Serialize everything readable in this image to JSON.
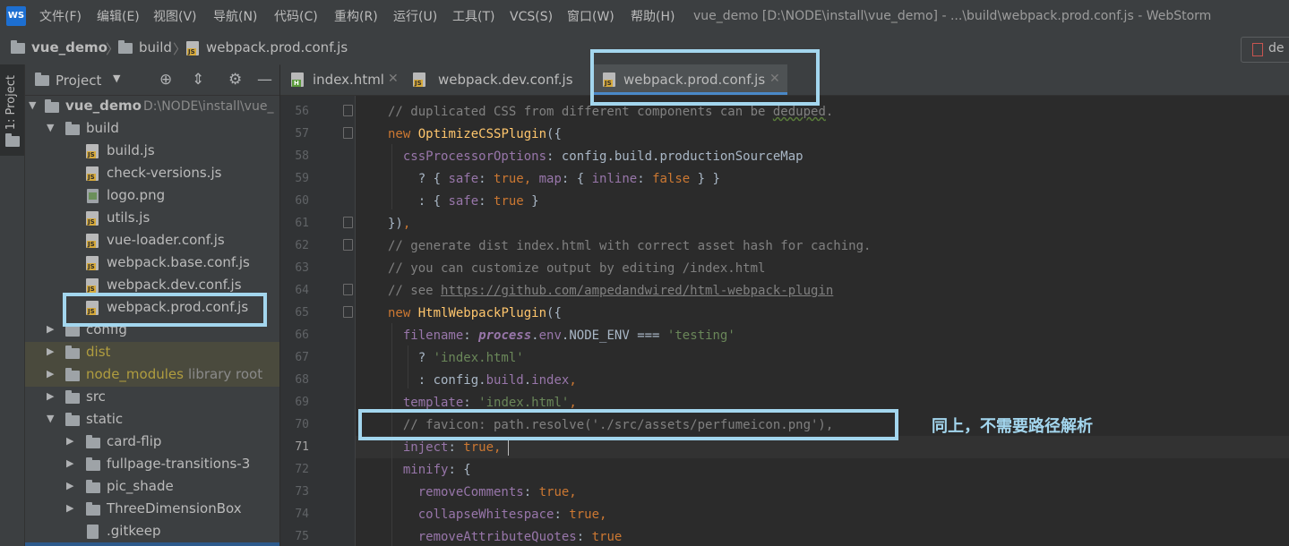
{
  "menubar": {
    "items": [
      "文件(F)",
      "编辑(E)",
      "视图(V)",
      "导航(N)",
      "代码(C)",
      "重构(R)",
      "运行(U)",
      "工具(T)",
      "VCS(S)",
      "窗口(W)",
      "帮助(H)"
    ],
    "window_title": "vue_demo [D:\\NODE\\install\\vue_demo] - ...\\build\\webpack.prod.conf.js - WebStorm",
    "logo": "WS"
  },
  "breadcrumb": [
    "vue_demo",
    "build",
    "webpack.prod.conf.js"
  ],
  "right_tab_label": "de",
  "toolstrip": {
    "project_label": "1: Project"
  },
  "project_panel": {
    "title": "Project",
    "tree": [
      {
        "label": "vue_demo",
        "path": "D:\\NODE\\install\\vue_",
        "kind": "root"
      },
      {
        "label": "build",
        "kind": "folder"
      },
      {
        "label": "build.js",
        "kind": "js"
      },
      {
        "label": "check-versions.js",
        "kind": "js"
      },
      {
        "label": "logo.png",
        "kind": "png"
      },
      {
        "label": "utils.js",
        "kind": "js"
      },
      {
        "label": "vue-loader.conf.js",
        "kind": "js"
      },
      {
        "label": "webpack.base.conf.js",
        "kind": "js"
      },
      {
        "label": "webpack.dev.conf.js",
        "kind": "js"
      },
      {
        "label": "webpack.prod.conf.js",
        "kind": "js"
      },
      {
        "label": "config",
        "kind": "folder"
      },
      {
        "label": "dist",
        "kind": "folder"
      },
      {
        "label": "node_modules",
        "extra": "library root",
        "kind": "folder"
      },
      {
        "label": "src",
        "kind": "folder"
      },
      {
        "label": "static",
        "kind": "folder"
      },
      {
        "label": "card-flip",
        "kind": "folder"
      },
      {
        "label": "fullpage-transitions-3",
        "kind": "folder"
      },
      {
        "label": "pic_shade",
        "kind": "folder"
      },
      {
        "label": "ThreeDimensionBox",
        "kind": "folder"
      },
      {
        "label": ".gitkeep",
        "kind": "file"
      }
    ]
  },
  "editor_tabs": [
    {
      "label": "index.html",
      "active": false
    },
    {
      "label": "webpack.dev.conf.js",
      "active": false
    },
    {
      "label": "webpack.prod.conf.js",
      "active": true
    }
  ],
  "editor": {
    "current_line": "71",
    "lines": [
      {
        "n": "56",
        "text": "// duplicated CSS from different components can be deduped."
      },
      {
        "n": "57",
        "text": "new OptimizeCSSPlugin({"
      },
      {
        "n": "58",
        "text": "  cssProcessorOptions: config.build.productionSourceMap"
      },
      {
        "n": "59",
        "text": "    ? { safe: true, map: { inline: false } }"
      },
      {
        "n": "60",
        "text": "    : { safe: true }"
      },
      {
        "n": "61",
        "text": "}),"
      },
      {
        "n": "62",
        "text": "// generate dist index.html with correct asset hash for caching."
      },
      {
        "n": "63",
        "text": "// you can customize output by editing /index.html"
      },
      {
        "n": "64",
        "text": "// see https://github.com/ampedandwired/html-webpack-plugin"
      },
      {
        "n": "65",
        "text": "new HtmlWebpackPlugin({"
      },
      {
        "n": "66",
        "text": "  filename: process.env.NODE_ENV === 'testing'"
      },
      {
        "n": "67",
        "text": "    ? 'index.html'"
      },
      {
        "n": "68",
        "text": "    : config.build.index,"
      },
      {
        "n": "69",
        "text": "  template: 'index.html',"
      },
      {
        "n": "70",
        "text": "  // favicon: path.resolve('./src/assets/perfumeicon.png'),"
      },
      {
        "n": "71",
        "text": "  inject: true,"
      },
      {
        "n": "72",
        "text": "  minify: {"
      },
      {
        "n": "73",
        "text": "    removeComments: true,"
      },
      {
        "n": "74",
        "text": "    collapseWhitespace: true,"
      },
      {
        "n": "75",
        "text": "    removeAttributeQuotes: true"
      }
    ]
  },
  "annotation_note": "同上，不需要路径解析",
  "colors": {
    "highlight_box": "#a3d6ee",
    "comment": "#808080",
    "keyword": "#cc7832",
    "string": "#6a8759",
    "property": "#9876aa",
    "class": "#ffc66d"
  }
}
